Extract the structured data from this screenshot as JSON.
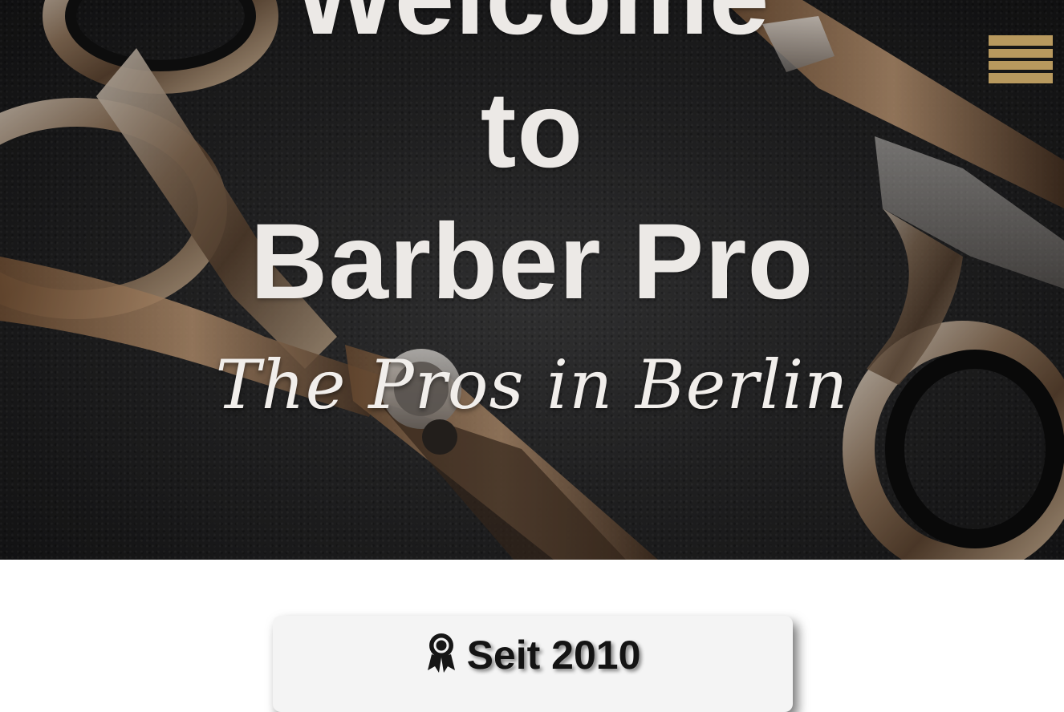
{
  "hero": {
    "title_line1": "Welcome",
    "title_line2": "to",
    "title_line3": "Barber Pro",
    "tagline": "The Pros in Berlin",
    "background_image": "scissors-on-leather"
  },
  "nav": {
    "menu_icon": "hamburger-menu-icon",
    "accent_color": "#b8995e"
  },
  "feature_card": {
    "icon": "award-ribbon-icon",
    "label": "Seit 2010"
  }
}
